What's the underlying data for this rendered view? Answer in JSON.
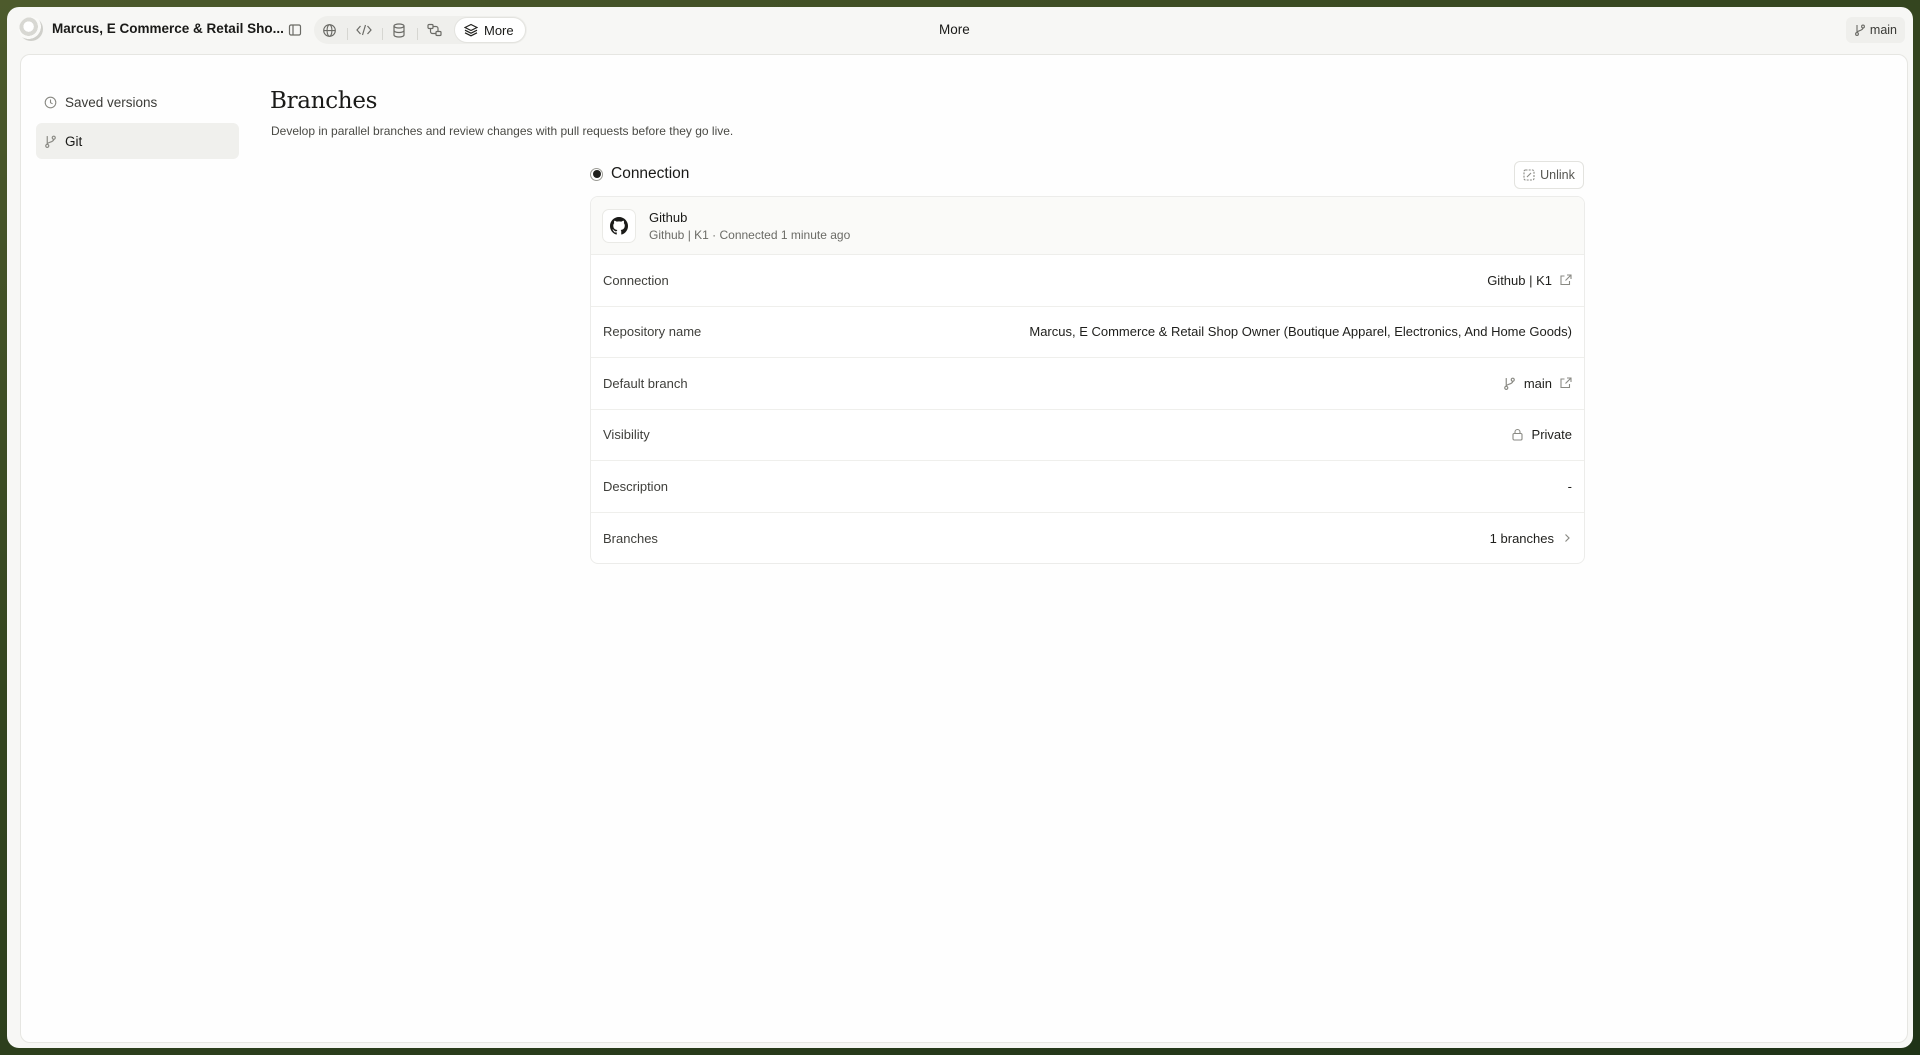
{
  "topbar": {
    "project_title": "Marcus, E Commerce & Retail Sho...",
    "more_label": "More",
    "center_title": "More",
    "branch": "main",
    "icons": [
      "sidebar-toggle-icon",
      "globe-icon",
      "code-icon",
      "database-icon",
      "workflow-icon",
      "layers-icon"
    ]
  },
  "sidebar": {
    "items": [
      {
        "label": "Saved versions",
        "icon": "clock-icon"
      },
      {
        "label": "Git",
        "icon": "git-branch-icon",
        "active": true
      }
    ]
  },
  "main": {
    "title": "Branches",
    "subtitle": "Develop in parallel branches and review changes with pull requests before they go live.",
    "section_title": "Connection",
    "unlink_label": "Unlink",
    "provider": {
      "name": "Github",
      "meta": "Github | K1 · Connected 1 minute ago"
    },
    "rows": [
      {
        "label": "Connection",
        "value": "Github | K1",
        "icon": "external-link-icon"
      },
      {
        "label": "Repository name",
        "value": "Marcus, E Commerce & Retail Shop Owner (Boutique Apparel, Electronics, And Home Goods)"
      },
      {
        "label": "Default branch",
        "value": "main",
        "icon": "external-link-icon"
      },
      {
        "label": "Visibility",
        "value": "Private",
        "icon": "lock-icon"
      },
      {
        "label": "Description",
        "value": "-"
      },
      {
        "label": "Branches",
        "value": "1 branches",
        "icon": "chevron-right-icon"
      }
    ]
  },
  "colors": {
    "background_gradient_start": "#4d5a2c",
    "background_gradient_end": "#1f3317",
    "panel": "#fefefe",
    "chrome": "#f7f7f5"
  }
}
